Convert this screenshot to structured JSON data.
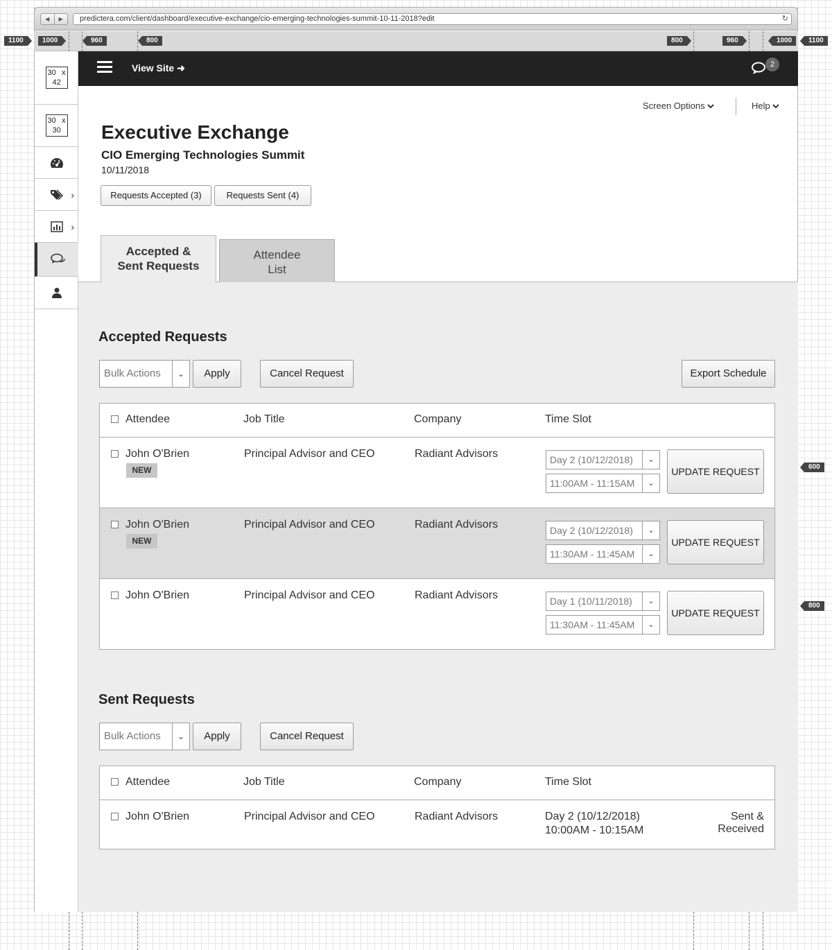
{
  "browser": {
    "url": "predictera.com/client/dashboard/executive-exchange/cio-emerging-technologies-summit-10-11-2018?edit",
    "back": "◀",
    "forward": "▶",
    "reload": "↻"
  },
  "ruler": {
    "left_labels": [
      "1100",
      "1000",
      "960",
      "800"
    ],
    "right_labels": [
      "800",
      "960",
      "1000",
      "1100"
    ],
    "side_markers": [
      "600",
      "800"
    ]
  },
  "leftrail": {
    "thumb1": {
      "top_left": "30",
      "top_right": "x",
      "bottom": "42"
    },
    "thumb2": {
      "top_left": "30",
      "top_right": "x",
      "bottom": "30"
    },
    "chevron": "›"
  },
  "topbar": {
    "view_site": "View Site",
    "view_site_arrow": "➜",
    "chat_badge": "2"
  },
  "header": {
    "screen_options": "Screen Options",
    "help": "Help",
    "title": "Executive Exchange",
    "subtitle": "CIO Emerging Technologies Summit",
    "date": "10/11/2018",
    "requests_accepted": "Requests Accepted (3)",
    "requests_sent": "Requests Sent (4)"
  },
  "tabs": [
    {
      "line1": "Accepted &",
      "line2": "Sent Requests"
    },
    {
      "line1": "Attendee",
      "line2": "List"
    }
  ],
  "accepted": {
    "title": "Accepted Requests",
    "bulk_actions": "Bulk Actions",
    "apply": "Apply",
    "cancel_request": "Cancel Request",
    "export_schedule": "Export Schedule",
    "columns": [
      "Attendee",
      "Job Title",
      "Company",
      "Time Slot"
    ],
    "rows": [
      {
        "attendee": "John O'Brien",
        "badge": "NEW",
        "job": "Principal Advisor and CEO",
        "company": "Radiant Advisors",
        "day": "Day 2 (10/12/2018)",
        "time": "11:00AM - 11:15AM",
        "button": "UPDATE REQUEST"
      },
      {
        "attendee": "John O'Brien",
        "badge": "NEW",
        "job": "Principal Advisor and CEO",
        "company": "Radiant Advisors",
        "day": "Day 2 (10/12/2018)",
        "time": "11:30AM - 11:45AM",
        "button": "UPDATE REQUEST"
      },
      {
        "attendee": "John O'Brien",
        "badge": "",
        "job": "Principal Advisor and CEO",
        "company": "Radiant Advisors",
        "day": "Day 1 (10/11/2018)",
        "time": "11:30AM - 11:45AM",
        "button": "UPDATE REQUEST"
      }
    ]
  },
  "sent": {
    "title": "Sent Requests",
    "bulk_actions": "Bulk Actions",
    "apply": "Apply",
    "cancel_request": "Cancel Request",
    "columns": [
      "Attendee",
      "Job Title",
      "Company",
      "Time Slot"
    ],
    "rows": [
      {
        "attendee": "John O'Brien",
        "job": "Principal Advisor and CEO",
        "company": "Radiant Advisors",
        "day": "Day 2 (10/12/2018)",
        "time": "10:00AM - 10:15AM",
        "status1": "Sent &",
        "status2": "Received"
      }
    ]
  }
}
